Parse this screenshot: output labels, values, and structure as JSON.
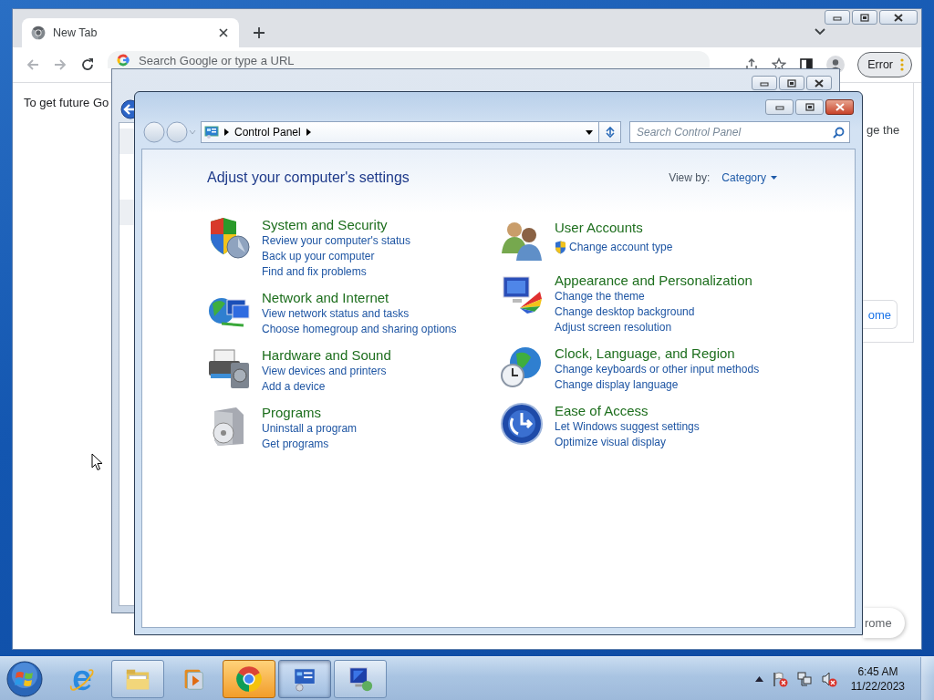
{
  "browser": {
    "tab": {
      "title": "New Tab"
    },
    "omnibox": {
      "placeholder": "Search Google or type a URL"
    },
    "profile_button": "Error",
    "page": {
      "text": "To get future Go",
      "card_text": "ge the",
      "card_button": "ome",
      "bottom_button": "rome"
    }
  },
  "control_panel": {
    "breadcrumb": [
      "Control Panel"
    ],
    "search": {
      "placeholder": "Search Control Panel"
    },
    "heading": "Adjust your computer's settings",
    "view_by": {
      "label": "View by:",
      "value": "Category"
    },
    "columns": [
      {
        "categories": [
          {
            "kind": "security",
            "title": "System and Security",
            "links": [
              {
                "text": "Review your computer's status",
                "shield": false
              },
              {
                "text": "Back up your computer",
                "shield": false
              },
              {
                "text": "Find and fix problems",
                "shield": false
              }
            ]
          },
          {
            "kind": "network",
            "title": "Network and Internet",
            "links": [
              {
                "text": "View network status and tasks",
                "shield": false
              },
              {
                "text": "Choose homegroup and sharing options",
                "shield": false
              }
            ]
          },
          {
            "kind": "hardware",
            "title": "Hardware and Sound",
            "links": [
              {
                "text": "View devices and printers",
                "shield": false
              },
              {
                "text": "Add a device",
                "shield": false
              }
            ]
          },
          {
            "kind": "programs",
            "title": "Programs",
            "links": [
              {
                "text": "Uninstall a program",
                "shield": false
              },
              {
                "text": "Get programs",
                "shield": false
              }
            ]
          }
        ]
      },
      {
        "categories": [
          {
            "kind": "accounts",
            "title": "User Accounts",
            "links": [
              {
                "text": "Change account type",
                "shield": true
              }
            ]
          },
          {
            "kind": "appearance",
            "title": "Appearance and Personalization",
            "links": [
              {
                "text": "Change the theme",
                "shield": false
              },
              {
                "text": "Change desktop background",
                "shield": false
              },
              {
                "text": "Adjust screen resolution",
                "shield": false
              }
            ]
          },
          {
            "kind": "clock",
            "title": "Clock, Language, and Region",
            "links": [
              {
                "text": "Change keyboards or other input methods",
                "shield": false
              },
              {
                "text": "Change display language",
                "shield": false
              }
            ]
          },
          {
            "kind": "access",
            "title": "Ease of Access",
            "links": [
              {
                "text": "Let Windows suggest settings",
                "shield": false
              },
              {
                "text": "Optimize visual display",
                "shield": false
              }
            ]
          }
        ]
      }
    ]
  },
  "taskbar": {
    "items": [
      {
        "kind": "web",
        "running": false,
        "flashing": false,
        "selected": false
      },
      {
        "kind": "files",
        "running": true,
        "flashing": false,
        "selected": false
      },
      {
        "kind": "media",
        "running": false,
        "flashing": false,
        "selected": false
      },
      {
        "kind": "browser",
        "running": true,
        "flashing": true,
        "selected": false
      },
      {
        "kind": "settings",
        "running": true,
        "flashing": false,
        "selected": true
      },
      {
        "kind": "remote",
        "running": true,
        "flashing": false,
        "selected": false
      }
    ],
    "clock": {
      "time": "6:45 AM",
      "date": "11/22/2023"
    }
  }
}
